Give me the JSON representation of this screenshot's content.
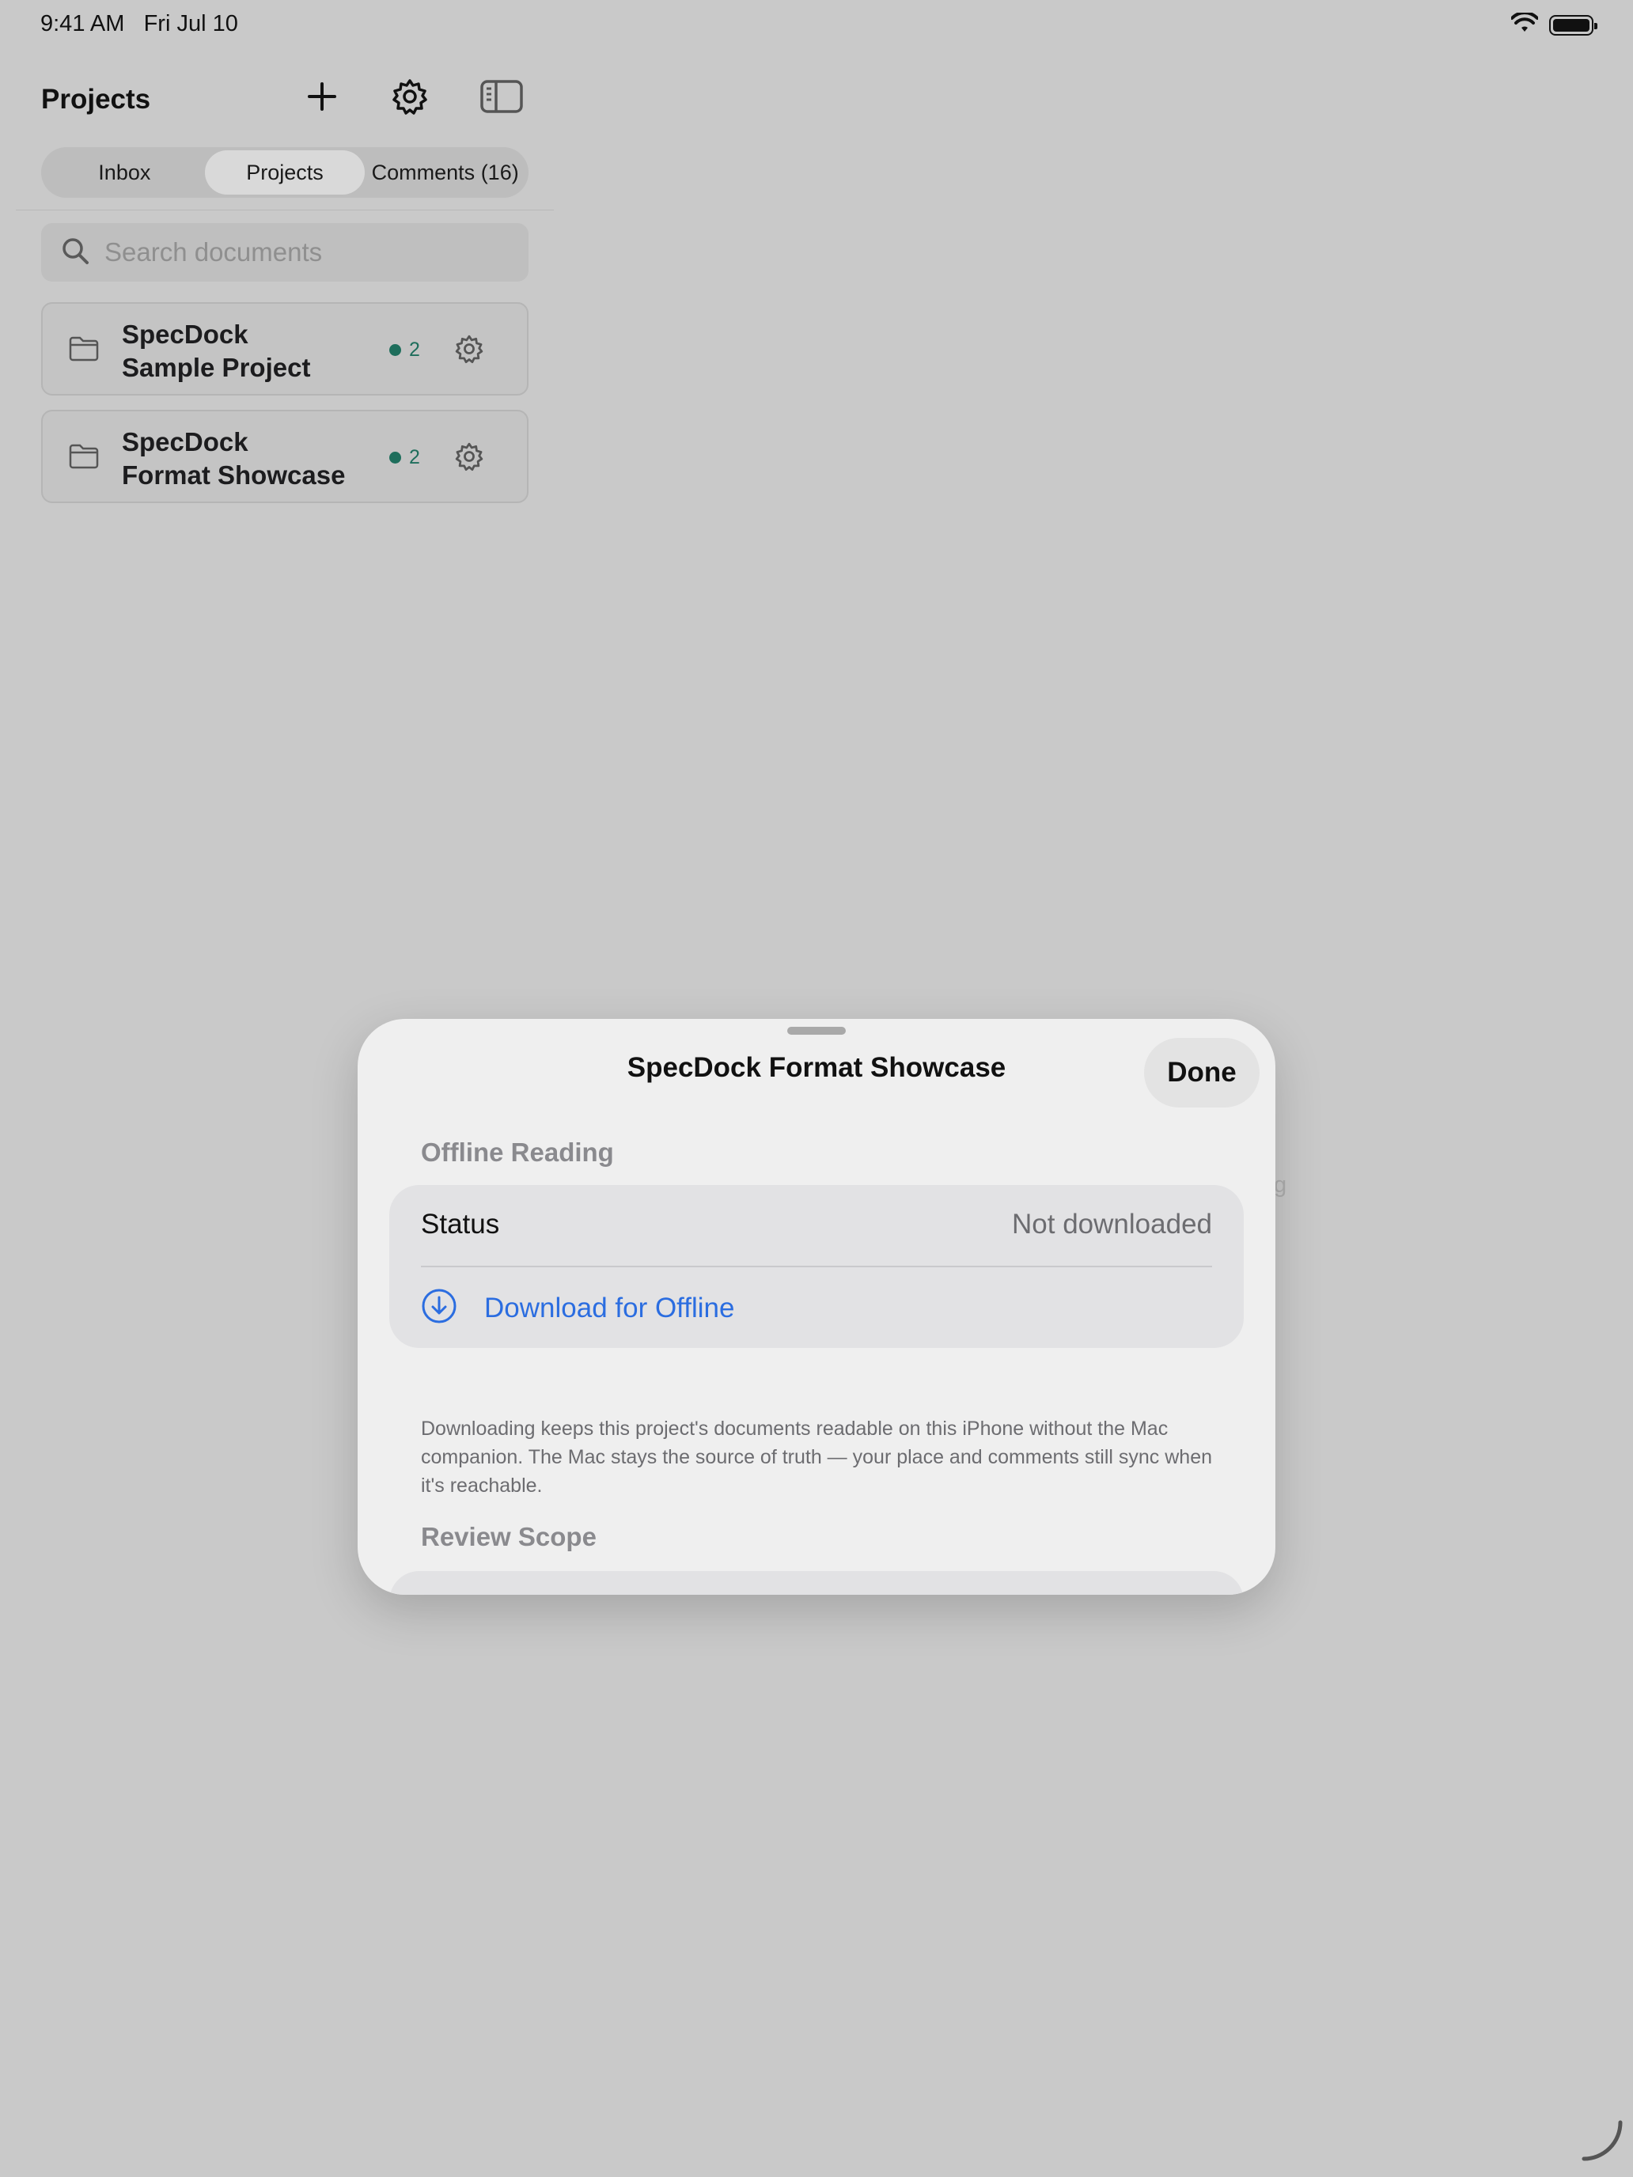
{
  "status_bar": {
    "time": "9:41 AM",
    "date": "Fri Jul 10",
    "icons": [
      "wifi-icon",
      "battery-icon"
    ]
  },
  "sidebar": {
    "title": "Projects",
    "toolbar_icons": [
      "plus-icon",
      "gear-icon",
      "sidebar-toggle-icon"
    ],
    "segments": [
      {
        "label": "Inbox",
        "active": false
      },
      {
        "label": "Projects",
        "active": true
      },
      {
        "label": "Comments (16)",
        "active": false
      }
    ],
    "search": {
      "placeholder": "Search documents",
      "icon": "search-icon"
    },
    "projects": [
      {
        "name_line1": "SpecDock",
        "name_line2": "Sample Project",
        "count": "2",
        "icon": "folder-icon"
      },
      {
        "name_line1": "SpecDock",
        "name_line2": "Format Showcase",
        "count": "2",
        "icon": "folder-icon"
      }
    ]
  },
  "background_ghost_text": "g",
  "sheet": {
    "title": "SpecDock Format Showcase",
    "done_label": "Done",
    "offline_section": {
      "header": "Offline Reading",
      "status_label": "Status",
      "status_value": "Not downloaded",
      "download_label": "Download for Offline",
      "download_icon": "download-circle-icon",
      "footnote": "Downloading keeps this project's documents readable on this iPhone without the Mac companion. The Mac stays the source of truth — your place and comments still sync when it's reachable."
    },
    "review_section": {
      "header": "Review Scope"
    }
  },
  "colors": {
    "accent_blue": "#2b6de0",
    "badge_green": "#1e6e5c",
    "dimmed_background": "#c9c9c9",
    "sheet_background": "#efefef"
  }
}
